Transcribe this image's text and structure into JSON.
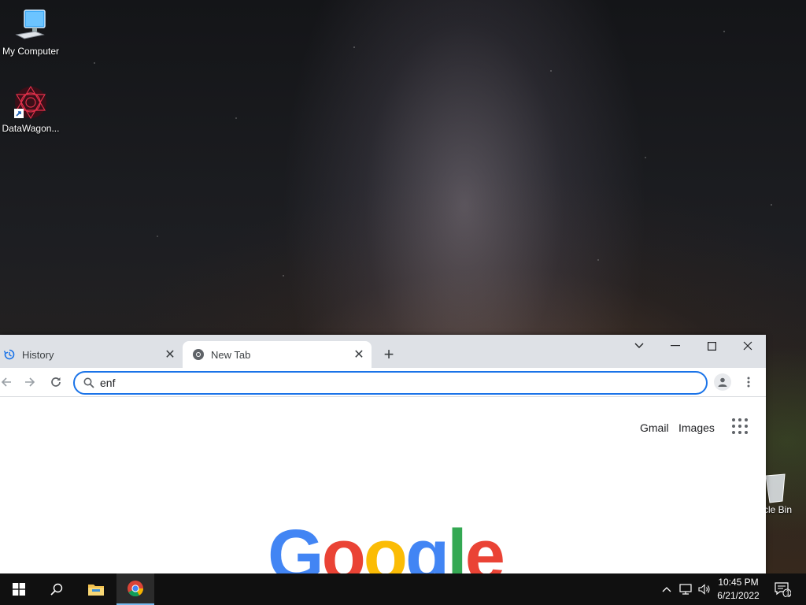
{
  "desktop": {
    "icons": [
      {
        "label": "My Computer"
      },
      {
        "label": "DataWagon..."
      }
    ],
    "recycle_bin_label": "cle Bin"
  },
  "browser": {
    "tabs": [
      {
        "title": "History",
        "icon": "history-icon",
        "active": false
      },
      {
        "title": "New Tab",
        "icon": "chrome-icon",
        "active": true
      }
    ],
    "omnibox": {
      "value": "enf",
      "placeholder": ""
    },
    "links": {
      "gmail": "Gmail",
      "images": "Images"
    },
    "logo": {
      "letters": [
        "G",
        "o",
        "o",
        "g",
        "l",
        "e"
      ],
      "colors": [
        "#4285f4",
        "#ea4335",
        "#fbbc05",
        "#4285f4",
        "#34a853",
        "#ea4335"
      ]
    },
    "accent_color": "#1a73e8"
  },
  "taskbar": {
    "time": "10:45 PM",
    "date": "6/21/2022",
    "notification_count": "1",
    "pinned": [
      "start-icon",
      "search-icon",
      "file-explorer-icon",
      "chrome-icon"
    ]
  }
}
